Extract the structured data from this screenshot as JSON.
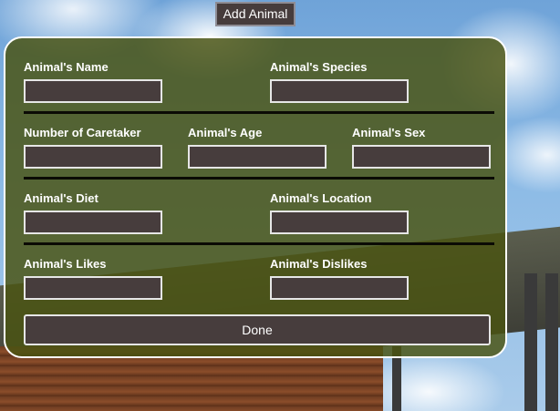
{
  "toolbar": {
    "add_animal_label": "Add Animal"
  },
  "form": {
    "row1": {
      "name_label": "Animal's Name",
      "name_value": "",
      "species_label": "Animal's Species",
      "species_value": ""
    },
    "row2": {
      "caretaker_label": "Number of Caretaker",
      "caretaker_value": "",
      "age_label": "Animal's Age",
      "age_value": "",
      "sex_label": "Animal's Sex",
      "sex_value": ""
    },
    "row3": {
      "diet_label": "Animal's Diet",
      "diet_value": "",
      "location_label": "Animal's Location",
      "location_value": ""
    },
    "row4": {
      "likes_label": "Animal's Likes",
      "likes_value": "",
      "dislikes_label": "Animal's Dislikes",
      "dislikes_value": ""
    },
    "done_label": "Done"
  },
  "colors": {
    "panel_background": "#4a5412",
    "field_background": "#473d3d",
    "field_border": "#e6e6e6",
    "button_background": "#463c3c"
  }
}
